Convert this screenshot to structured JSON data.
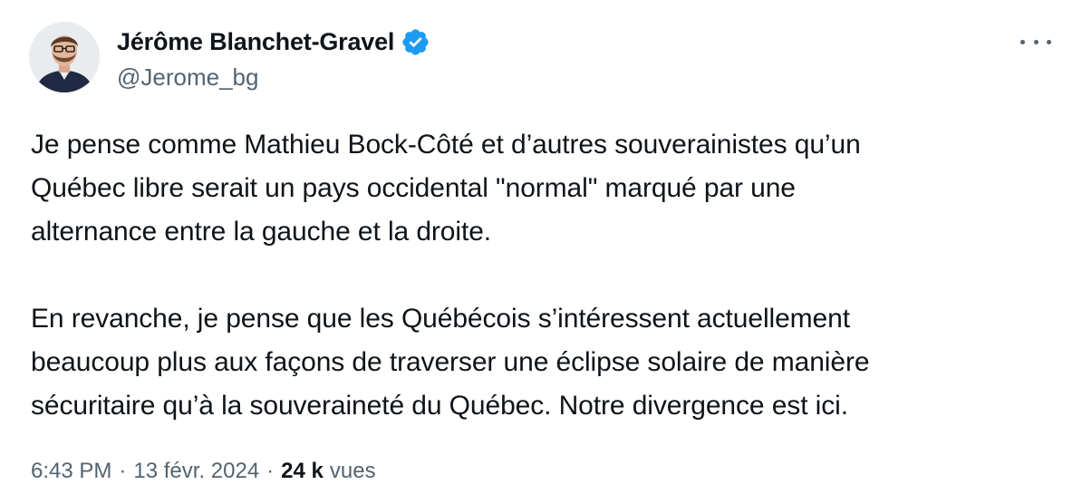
{
  "author": {
    "display_name": "Jérôme Blanchet-Gravel",
    "handle": "@Jerome_bg",
    "verified_badge_icon": "verified-checkmark-icon",
    "avatar_icon": "profile-photo"
  },
  "tweet": {
    "paragraphs": [
      "Je pense comme Mathieu Bock-Côté et d’autres souverainistes qu’un\nQuébec libre serait un pays occidental \"normal\" marqué par une\nalternance entre la gauche et la droite.",
      "En revanche, je pense que les Québécois s’intéressent actuellement\nbeaucoup plus aux façons de traverser une éclipse solaire de manière\nsécuritaire qu’à la souveraineté du Québec. Notre divergence est ici."
    ]
  },
  "meta": {
    "time": "6:43 PM",
    "separator": "·",
    "date": "13 févr. 2024",
    "views_count": "24 k",
    "views_label": "vues"
  },
  "menu": {
    "more_icon": "more-options-icon"
  },
  "colors": {
    "text": "#0f1419",
    "secondary_text": "#536471",
    "verified_blue": "#1d9bf0",
    "background": "#ffffff"
  }
}
